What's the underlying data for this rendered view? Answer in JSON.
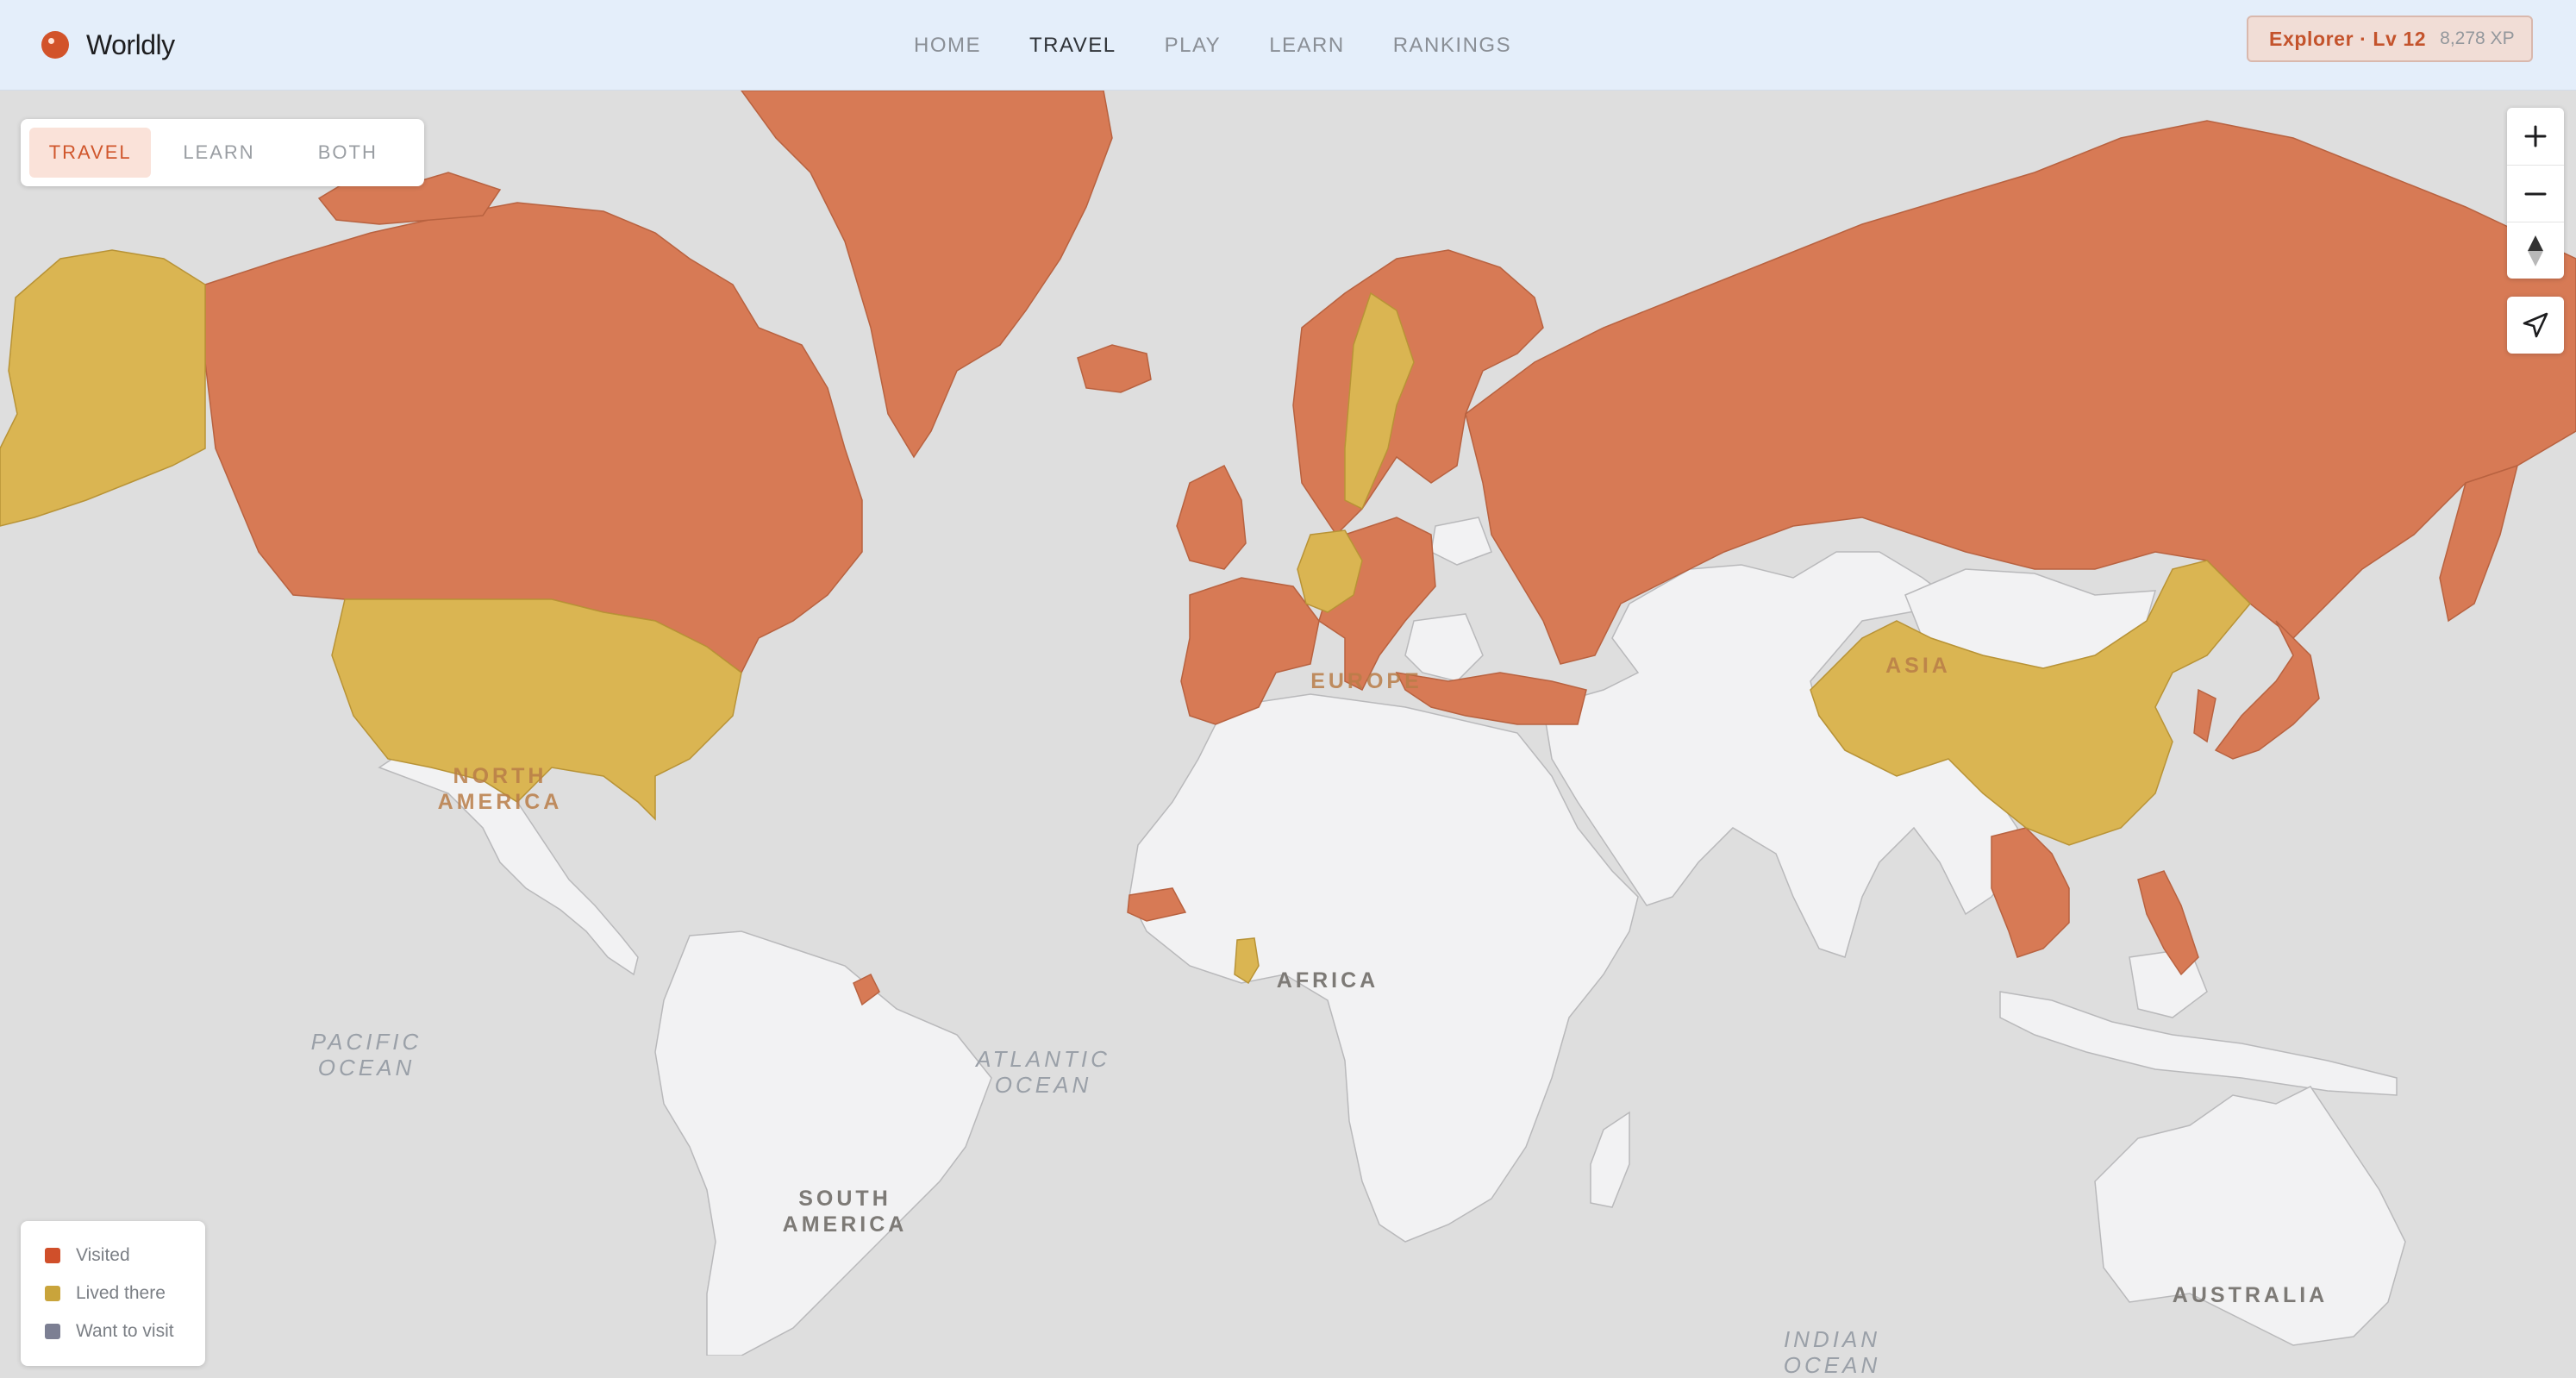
{
  "app": {
    "name": "Worldly"
  },
  "nav": {
    "items": [
      {
        "label": "HOME",
        "active": false
      },
      {
        "label": "TRAVEL",
        "active": true
      },
      {
        "label": "PLAY",
        "active": false
      },
      {
        "label": "LEARN",
        "active": false
      },
      {
        "label": "RANKINGS",
        "active": false
      }
    ]
  },
  "profile": {
    "level_label": "Explorer · Lv 12",
    "xp_label": "8,278 XP"
  },
  "mode_toggle": {
    "options": [
      "TRAVEL",
      "LEARN",
      "BOTH"
    ],
    "selected": "TRAVEL"
  },
  "map_controls": {
    "zoom_in_icon": "plus-icon",
    "zoom_out_icon": "minus-icon",
    "compass_icon": "compass-icon",
    "locate_icon": "location-arrow-icon"
  },
  "map": {
    "continent_labels": {
      "north_america": [
        "NORTH",
        "AMERICA"
      ],
      "south_america": [
        "SOUTH",
        "AMERICA"
      ],
      "europe": "EUROPE",
      "africa": "AFRICA",
      "asia": "ASIA",
      "australia": "AUSTRALIA"
    },
    "ocean_labels": {
      "pacific": [
        "PACIFIC",
        "OCEAN"
      ],
      "atlantic": [
        "ATLANTIC",
        "OCEAN"
      ],
      "indian": [
        "INDIAN",
        "OCEAN"
      ]
    },
    "countries": {
      "visited": [
        "Canada",
        "Greenland",
        "Iceland",
        "Norway",
        "Finland",
        "Russia",
        "United Kingdom",
        "Ireland",
        "France",
        "Spain",
        "Portugal",
        "Italy",
        "Poland",
        "Austria",
        "Czechia",
        "Switzerland",
        "Ukraine",
        "Greece",
        "Turkey",
        "Japan",
        "South Korea",
        "Thailand",
        "Vietnam",
        "Cambodia",
        "Laos",
        "Philippines",
        "Senegal",
        "Suriname"
      ],
      "lived_there": [
        "United States",
        "Sweden",
        "Germany",
        "China",
        "Ghana"
      ],
      "want_to_visit": []
    }
  },
  "colors": {
    "visited": "#d77a55",
    "lived_there": "#dab552",
    "want_to_visit": "#7c7f93",
    "unvisited_land": "#f2f2f3",
    "water": "#dedede",
    "accent": "#d2532a"
  },
  "legend": {
    "items": [
      {
        "label": "Visited",
        "color": "#d04f2a"
      },
      {
        "label": "Lived there",
        "color": "#c9a43b"
      },
      {
        "label": "Want to visit",
        "color": "#7c7f93"
      }
    ]
  }
}
